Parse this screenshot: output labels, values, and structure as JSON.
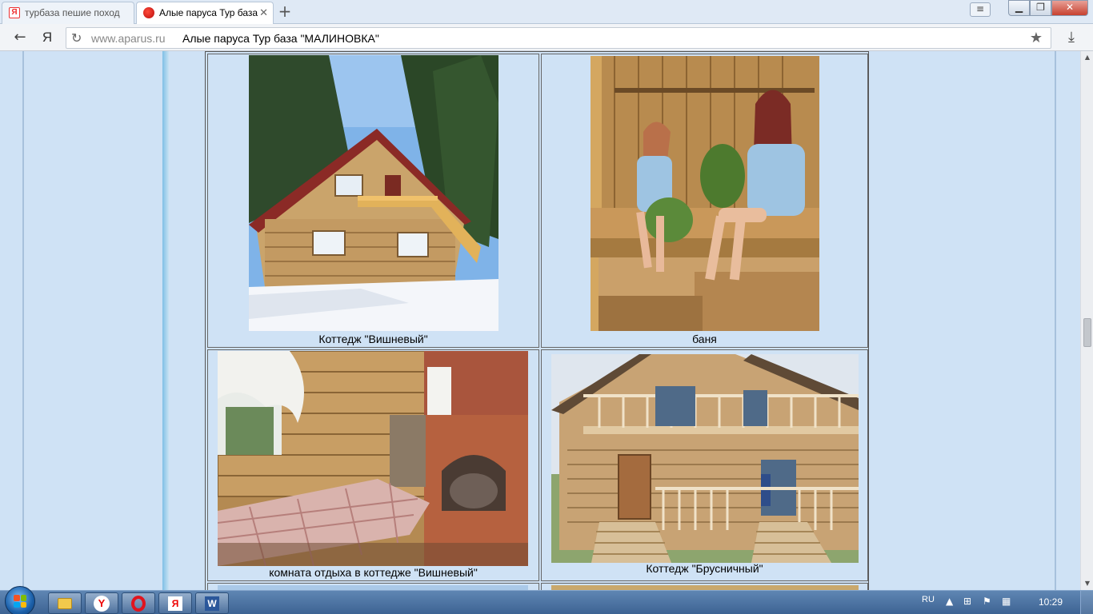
{
  "browser": {
    "tabs": [
      {
        "label": "турбаза пешие поход",
        "active": false,
        "favicon": "yandex-icon"
      },
      {
        "label": "Алые паруса Тур база",
        "active": true,
        "favicon": "aparus-icon"
      }
    ],
    "address": {
      "domain": "www.aparus.ru",
      "title": "Алые паруса Тур база \"МАЛИНОВКА\""
    },
    "yandex_button": "Я"
  },
  "gallery": {
    "items": [
      {
        "caption": "Коттедж \"Вишневый\"",
        "photo": "cottage-vishnevy-exterior"
      },
      {
        "caption": "баня",
        "photo": "sauna"
      },
      {
        "caption": "комната отдыха в коттедже \"Вишневый\"",
        "photo": "lounge-room"
      },
      {
        "caption": "Коттедж \"Брусничный\"",
        "photo": "cottage-brusnichny-exterior"
      }
    ]
  },
  "taskbar": {
    "language": "RU",
    "clock": "10:29",
    "apps": [
      "explorer-icon",
      "yandex-browser-icon",
      "opera-icon",
      "yandex-icon",
      "word-icon"
    ]
  },
  "colors": {
    "page_bg": "#cfe2f5",
    "sidebar_accent": "#7fc0e6",
    "taskbar": "#3d6393"
  }
}
